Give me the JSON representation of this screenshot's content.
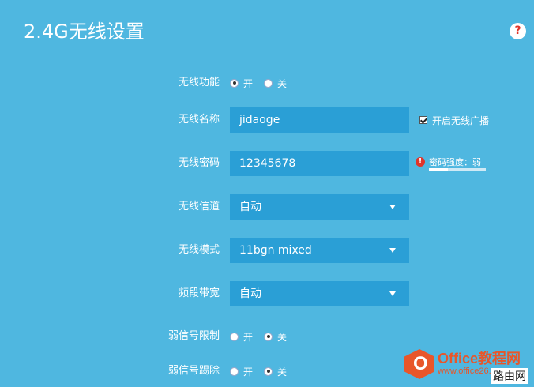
{
  "header": {
    "title": "2.4G无线设置",
    "help_icon": "?"
  },
  "rows": {
    "wireless_function": {
      "label": "无线功能",
      "on": "开",
      "off": "关",
      "selected": "on"
    },
    "ssid": {
      "label": "无线名称",
      "value": "jidaoge",
      "broadcast_label": "开启无线广播",
      "broadcast_checked": true
    },
    "password": {
      "label": "无线密码",
      "value": "12345678",
      "strength_text": "密码强度：弱",
      "strength_level": 0.33
    },
    "channel": {
      "label": "无线信道",
      "value": "自动"
    },
    "mode": {
      "label": "无线模式",
      "value": "11bgn mixed"
    },
    "bandwidth": {
      "label": "频段带宽",
      "value": "自动"
    },
    "weak_limit": {
      "label": "弱信号限制",
      "on": "开",
      "off": "关",
      "selected": "off"
    },
    "weak_kick": {
      "label": "弱信号踢除",
      "on": "开",
      "off": "关",
      "selected": "off"
    }
  },
  "watermark": {
    "brand": "Office教程网",
    "url": "www.office26.com",
    "sub": "路由网",
    "logo_letter": "O"
  },
  "colors": {
    "background": "#4fb7e0",
    "field": "#2a9fd6",
    "warning": "#e0342a",
    "brand": "#e8562a"
  }
}
